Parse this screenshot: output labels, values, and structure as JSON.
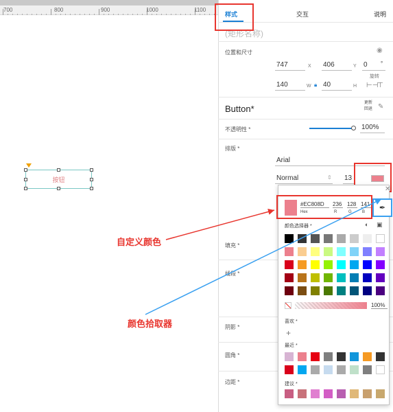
{
  "ruler": {
    "ticks": [
      "700",
      "800",
      "900",
      "1000",
      "1100"
    ]
  },
  "canvas": {
    "button_text": "按钮"
  },
  "callouts": {
    "custom_color": "自定义颜色",
    "picker": "颜色拾取器"
  },
  "colors": {
    "callout_red": "#e8352e",
    "callout_blue": "#3aa0f0",
    "tab_active": "#1a7fd4",
    "accent_highlight": "#e8352e"
  },
  "inspector": {
    "tabs": [
      "样式",
      "交互",
      "说明"
    ],
    "shape_name_placeholder": "(矩形名称)",
    "position_size_label": "位置和尺寸",
    "x": "747",
    "x_label": "X",
    "y": "406",
    "y_label": "Y",
    "rotate": "0",
    "rotate_unit": "°",
    "rotate_label": "旋转",
    "w": "140",
    "w_label": "W",
    "h": "40",
    "h_label": "H",
    "style_name": "Button*",
    "update_style": "更新\n回退",
    "opacity_label": "不透明性 *",
    "opacity_value": "100%",
    "typography_label": "排版 *",
    "font": "Arial",
    "font_weight": "Normal",
    "font_size": "13",
    "fill_label": "填充 *",
    "border_label": "线段 *",
    "shadow_label": "阴影 *",
    "corner_label": "圆角 *",
    "padding_label": "边距 *"
  },
  "color_picker": {
    "hex": "#EC808D",
    "hex_label": "Hex",
    "r": "236",
    "g": "128",
    "b": "141",
    "r_label": "R",
    "g_label": "G",
    "b_label": "B",
    "swatch_color": "#ec808d",
    "selector_label": "颜色选择器 *",
    "opacity": "100%",
    "favorites_label": "喜欢 *",
    "add_symbol": "+",
    "recent_label": "最近 *",
    "suggest_label": "建议 *",
    "grid": [
      [
        "#000000",
        "#333333",
        "#555555",
        "#777777",
        "#aaaaaa",
        "#cccccc",
        "#eeeeee",
        "#ffffff"
      ],
      [
        "#ec808d",
        "#facd91",
        "#ffff80",
        "#caf982",
        "#80ffff",
        "#81d3f8",
        "#8080ff",
        "#c280ff"
      ],
      [
        "#d9001b",
        "#f59a23",
        "#ffff00",
        "#95f204",
        "#00ffff",
        "#02a7f0",
        "#0000ff",
        "#8400ff"
      ],
      [
        "#a30014",
        "#b8741a",
        "#bfbf00",
        "#70b603",
        "#00bfbf",
        "#027db4",
        "#0000bf",
        "#6300bf"
      ],
      [
        "#6d000e",
        "#7b4d12",
        "#808000",
        "#4b7902",
        "#008080",
        "#015478",
        "#000080",
        "#4b0080"
      ]
    ],
    "recent": [
      [
        "#d7b4d3",
        "#ec808d",
        "#e60012",
        "#7f7f7f",
        "#333333",
        "#1296db",
        "#f59a23",
        "#333333"
      ],
      [
        "#d9001b",
        "#02a7f0",
        "#aaaaaa",
        "#c6dbef",
        "#aaaaaa",
        "#bfe0c9",
        "#7f7f7f",
        "#ffffff"
      ]
    ],
    "suggest": [
      "#c85e82",
      "#c8727a",
      "#e07fd0",
      "#d35ec5",
      "#b85fb0",
      "#e0b878",
      "#c8a06e",
      "#c8a86e"
    ]
  }
}
